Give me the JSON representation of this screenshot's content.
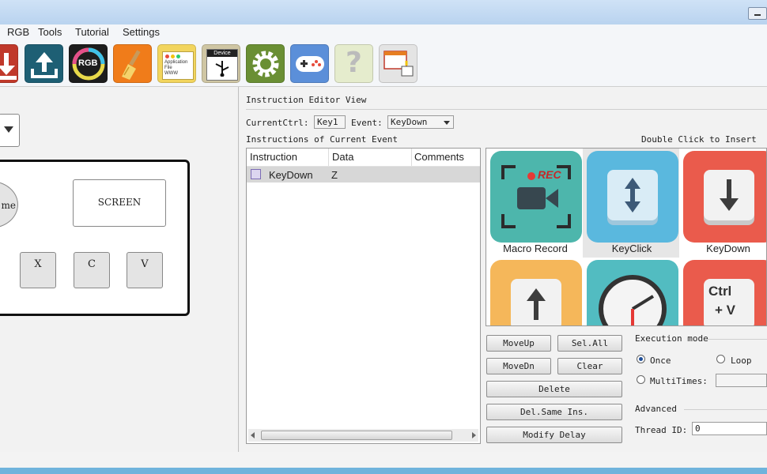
{
  "menu": [
    "RGB",
    "Tools",
    "Tutorial",
    "Settings"
  ],
  "toolbar": {
    "application_icon_text": "Application\nFile\nWWW",
    "device_icon_text": "Device",
    "rgb_icon_text": "RGB"
  },
  "left": {
    "keypad_labels": {
      "home_fragment": "me",
      "screen": "SCREEN",
      "x": "X",
      "c": "C",
      "v": "V"
    }
  },
  "editor": {
    "view_title": "Instruction Editor View",
    "current_ctrl_label": "CurrentCtrl:",
    "current_ctrl_value": "Key1",
    "event_label": "Event:",
    "event_value": "KeyDown",
    "instructions_label": "Instructions of Current Event",
    "double_click_hint": "Double Click to Insert",
    "columns": [
      "Instruction",
      "Data",
      "Comments"
    ],
    "rows": [
      {
        "instruction": "KeyDown",
        "data": "Z",
        "comments": ""
      }
    ]
  },
  "palette": {
    "items": [
      {
        "label": "Macro Record",
        "color": "#4db6ac",
        "rec_text": "REC"
      },
      {
        "label": "KeyClick",
        "color": "#5ab8de"
      },
      {
        "label": "KeyDown",
        "color": "#ea5b4c"
      },
      {
        "label": "",
        "color": "#f5b75a"
      },
      {
        "label": "",
        "color": "#52bcc1"
      },
      {
        "label": "",
        "color": "#ea5b4c",
        "ctrl_text": "Ctrl",
        "plus_v_text": "+ V"
      }
    ]
  },
  "buttons": {
    "move_up": "MoveUp",
    "sel_all": "Sel.All",
    "move_dn": "MoveDn",
    "clear": "Clear",
    "delete": "Delete",
    "del_same": "Del.Same Ins.",
    "modify_delay": "Modify Delay"
  },
  "execution": {
    "title": "Execution mode",
    "once": "Once",
    "loop": "Loop",
    "multitimes": "MultiTimes:",
    "selected": "once"
  },
  "advanced": {
    "title": "Advanced",
    "thread_label": "Thread ID:",
    "thread_value": "0"
  },
  "colors": {
    "accent_blue": "#6fb3dc",
    "download_red": "#c0392b",
    "upload_teal": "#1e5f74",
    "rgb_dark": "#1d1d1d",
    "brush_orange": "#f07c1a",
    "gear_green": "#6a8f34",
    "gamepad_blue": "#5b8fd9",
    "help_pale": "#e5eccd"
  }
}
